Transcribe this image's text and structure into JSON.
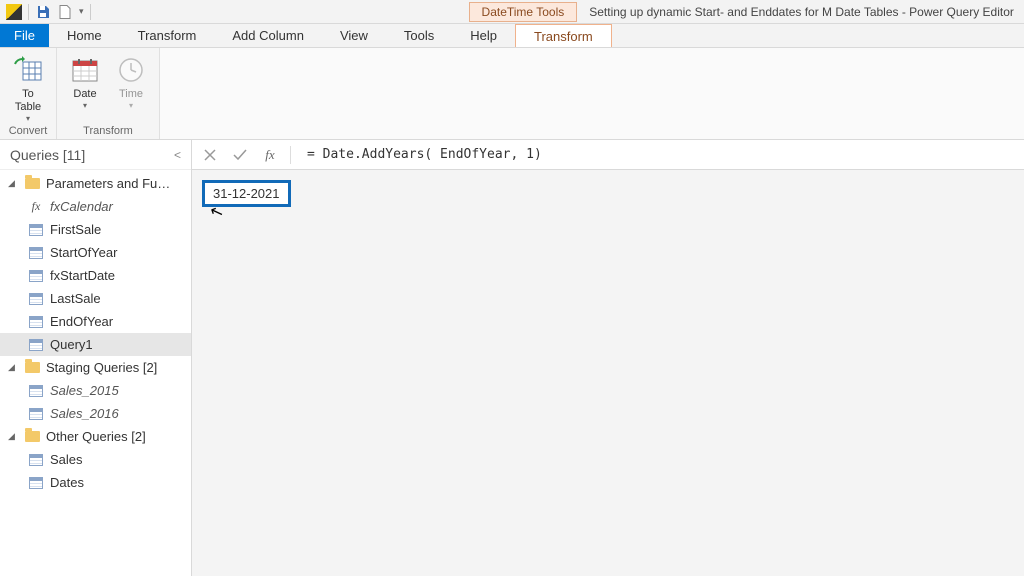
{
  "qat": {
    "tool_tab": "DateTime Tools",
    "title": "Setting up dynamic Start- and Enddates for M Date Tables - Power Query Editor"
  },
  "tabs": {
    "file": "File",
    "items": [
      "Home",
      "Transform",
      "Add Column",
      "View",
      "Tools",
      "Help"
    ],
    "contextual": "Transform"
  },
  "ribbon": {
    "convert": {
      "to_table": "To\nTable",
      "group_label": "Convert"
    },
    "transform": {
      "date": "Date",
      "time": "Time",
      "group_label": "Transform"
    }
  },
  "sidebar": {
    "header": "Queries [11]",
    "groups": [
      {
        "label": "Parameters and Fu…",
        "items": [
          {
            "label": "fxCalendar",
            "icon": "fx",
            "italic": true
          },
          {
            "label": "FirstSale",
            "icon": "table"
          },
          {
            "label": "StartOfYear",
            "icon": "table"
          },
          {
            "label": "fxStartDate",
            "icon": "table"
          },
          {
            "label": "LastSale",
            "icon": "table"
          },
          {
            "label": "EndOfYear",
            "icon": "table"
          },
          {
            "label": "Query1",
            "icon": "table",
            "selected": true
          }
        ]
      },
      {
        "label": "Staging Queries [2]",
        "items": [
          {
            "label": "Sales_2015",
            "icon": "table",
            "italic": true
          },
          {
            "label": "Sales_2016",
            "icon": "table",
            "italic": true
          }
        ]
      },
      {
        "label": "Other Queries [2]",
        "items": [
          {
            "label": "Sales",
            "icon": "table"
          },
          {
            "label": "Dates",
            "icon": "table"
          }
        ]
      }
    ]
  },
  "formula_bar": {
    "value": "= Date.AddYears( EndOfYear, 1)"
  },
  "result": {
    "value": "31-12-2021"
  }
}
